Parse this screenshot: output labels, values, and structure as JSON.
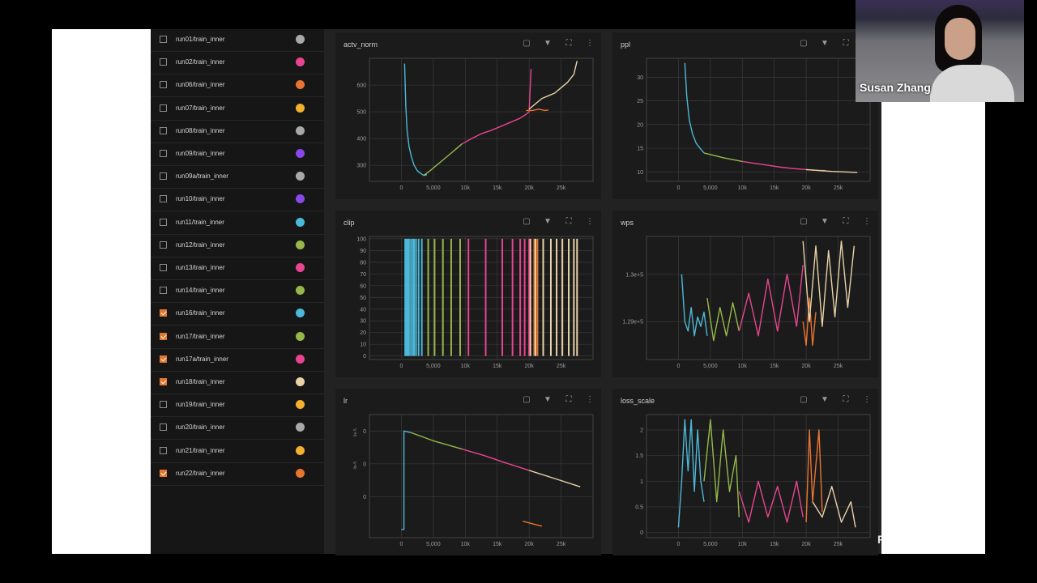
{
  "runs": [
    {
      "label": "run01/train_inner",
      "color": "#a8a8a8",
      "checked": false
    },
    {
      "label": "run02/train_inner",
      "color": "#e84590",
      "checked": false
    },
    {
      "label": "run06/train_inner",
      "color": "#e87530",
      "checked": false
    },
    {
      "label": "run07/train_inner",
      "color": "#f2b02e",
      "checked": false
    },
    {
      "label": "run08/train_inner",
      "color": "#a8a8a8",
      "checked": false
    },
    {
      "label": "run09/train_inner",
      "color": "#8a48e8",
      "checked": false
    },
    {
      "label": "run09a/train_inner",
      "color": "#a8a8a8",
      "checked": false
    },
    {
      "label": "run10/train_inner",
      "color": "#8a48e8",
      "checked": false
    },
    {
      "label": "run11/train_inner",
      "color": "#4db8d8",
      "checked": false
    },
    {
      "label": "run12/train_inner",
      "color": "#96b84a",
      "checked": false
    },
    {
      "label": "run13/train_inner",
      "color": "#e84590",
      "checked": false
    },
    {
      "label": "run14/train_inner",
      "color": "#96b84a",
      "checked": false
    },
    {
      "label": "run16/train_inner",
      "color": "#4db8d8",
      "checked": true
    },
    {
      "label": "run17/train_inner",
      "color": "#96b84a",
      "checked": true
    },
    {
      "label": "run17a/train_inner",
      "color": "#e84590",
      "checked": true
    },
    {
      "label": "run18/train_inner",
      "color": "#e8d2a8",
      "checked": true
    },
    {
      "label": "run19/train_inner",
      "color": "#f2b02e",
      "checked": false
    },
    {
      "label": "run20/train_inner",
      "color": "#a8a8a8",
      "checked": false
    },
    {
      "label": "run21/train_inner",
      "color": "#f2b02e",
      "checked": false
    },
    {
      "label": "run22/train_inner",
      "color": "#e87530",
      "checked": true
    }
  ],
  "icons": {
    "fit": "fit-domain-icon",
    "pin": "pin-icon",
    "fullscreen": "fullscreen-icon",
    "more": "more-vert-icon"
  },
  "colors": {
    "run16": "#4db8d8",
    "run17": "#96b84a",
    "run17a": "#e84590",
    "run18": "#e8d2a8",
    "run22": "#e87530"
  },
  "webcam": {
    "name": "Susan Zhang"
  },
  "watermark": "Powered by Zoom",
  "chart_data": [
    {
      "id": "actv_norm",
      "type": "line",
      "title": "actv_norm",
      "xticks": [
        "0",
        "5,000",
        "10k",
        "15k",
        "20k",
        "25k"
      ],
      "xtick_values": [
        0,
        5000,
        10000,
        15000,
        20000,
        25000
      ],
      "xlim": [
        -5000,
        30000
      ],
      "yticks": [
        "300",
        "400",
        "500",
        "600"
      ],
      "ytick_values": [
        300,
        400,
        500,
        600
      ],
      "ylim": [
        240,
        700
      ],
      "series": [
        {
          "color": "#4db8d8",
          "x": [
            500,
            700,
            900,
            1200,
            1600,
            2000,
            2500,
            3000,
            3500,
            4000
          ],
          "y": [
            680,
            520,
            430,
            370,
            330,
            300,
            280,
            270,
            262,
            265
          ]
        },
        {
          "color": "#96b84a",
          "x": [
            3500,
            4500,
            5500,
            6500,
            7500,
            8500,
            9500
          ],
          "y": [
            262,
            280,
            300,
            320,
            340,
            360,
            380
          ]
        },
        {
          "color": "#e84590",
          "x": [
            9500,
            11000,
            12500,
            14000,
            15500,
            17000,
            18500,
            19500,
            20000,
            20300
          ],
          "y": [
            380,
            400,
            418,
            430,
            445,
            460,
            475,
            490,
            500,
            660
          ]
        },
        {
          "color": "#e87530",
          "x": [
            19500,
            20500,
            21500,
            22500,
            23000
          ],
          "y": [
            505,
            505,
            510,
            505,
            507
          ]
        },
        {
          "color": "#e8d2a8",
          "x": [
            20000,
            21000,
            22000,
            23000,
            24000,
            25000,
            26000,
            27000,
            27500
          ],
          "y": [
            510,
            530,
            550,
            560,
            570,
            590,
            610,
            640,
            690
          ]
        }
      ]
    },
    {
      "id": "ppl",
      "type": "line",
      "title": "ppl",
      "xticks": [
        "0",
        "5,000",
        "10k",
        "15k",
        "20k",
        "25k"
      ],
      "xtick_values": [
        0,
        5000,
        10000,
        15000,
        20000,
        25000
      ],
      "xlim": [
        -5000,
        30000
      ],
      "yticks": [
        "10",
        "15",
        "20",
        "25",
        "30"
      ],
      "ytick_values": [
        10,
        15,
        20,
        25,
        30
      ],
      "ylim": [
        8,
        34
      ],
      "series": [
        {
          "color": "#4db8d8",
          "x": [
            1000,
            1300,
            1700,
            2200,
            2800,
            3500,
            4000
          ],
          "y": [
            33,
            26,
            21,
            18,
            16,
            14.8,
            14
          ]
        },
        {
          "color": "#96b84a",
          "x": [
            4000,
            5500,
            7000,
            8500,
            10000
          ],
          "y": [
            14,
            13.5,
            13,
            12.6,
            12.2
          ]
        },
        {
          "color": "#e84590",
          "x": [
            10000,
            12000,
            14000,
            16000,
            18000,
            20000
          ],
          "y": [
            12.2,
            11.8,
            11.4,
            11,
            10.7,
            10.5
          ]
        },
        {
          "color": "#e87530",
          "x": [
            20000,
            21000,
            22000,
            23000
          ],
          "y": [
            10.5,
            10.4,
            10.3,
            10.3
          ]
        },
        {
          "color": "#e8d2a8",
          "x": [
            20000,
            22000,
            24000,
            26000,
            28000
          ],
          "y": [
            10.5,
            10.3,
            10.1,
            10,
            9.9
          ]
        }
      ]
    },
    {
      "id": "clip",
      "type": "line",
      "title": "clip",
      "xticks": [
        "0",
        "5,000",
        "10k",
        "15k",
        "20k",
        "25k"
      ],
      "xtick_values": [
        0,
        5000,
        10000,
        15000,
        20000,
        25000
      ],
      "xlim": [
        -5000,
        30000
      ],
      "yticks": [
        "0",
        "10",
        "20",
        "30",
        "40",
        "50",
        "60",
        "70",
        "80",
        "90",
        "100"
      ],
      "ytick_values": [
        0,
        10,
        20,
        30,
        40,
        50,
        60,
        70,
        80,
        90,
        100
      ],
      "ylim": [
        -3,
        102
      ],
      "series": [
        {
          "color": "#4db8d8",
          "x": [
            600,
            800,
            1000,
            1200,
            1500,
            1800,
            2000,
            2300,
            2700,
            3200
          ],
          "y": [
            100,
            100,
            100,
            100,
            100,
            100,
            100,
            100,
            100,
            100
          ]
        },
        {
          "color": "#96b84a",
          "x": [
            4200,
            5200,
            6500,
            7800,
            9200
          ],
          "y": [
            100,
            100,
            100,
            100,
            100
          ]
        },
        {
          "color": "#e84590",
          "x": [
            10500,
            13200,
            15800,
            17400,
            18600,
            19300,
            20000
          ],
          "y": [
            100,
            100,
            100,
            100,
            100,
            100,
            100
          ]
        },
        {
          "color": "#e87530",
          "x": [
            20800,
            21300
          ],
          "y": [
            100,
            100
          ]
        },
        {
          "color": "#e8d2a8",
          "x": [
            20200,
            21000,
            22200,
            23400,
            24300,
            25200,
            26200,
            27000,
            27500
          ],
          "y": [
            100,
            100,
            100,
            100,
            100,
            100,
            100,
            100,
            100
          ]
        }
      ]
    },
    {
      "id": "wps",
      "type": "line",
      "title": "wps",
      "xticks": [
        "0",
        "5,000",
        "10k",
        "15k",
        "20k",
        "25k"
      ],
      "xtick_values": [
        0,
        5000,
        10000,
        15000,
        20000,
        25000
      ],
      "xlim": [
        -5000,
        30000
      ],
      "yticks": [
        "1.29e+5",
        "1.3e+5"
      ],
      "ytick_values": [
        129000,
        130000
      ],
      "ylim": [
        128200,
        130800
      ],
      "series": [
        {
          "color": "#4db8d8",
          "x": [
            500,
            1000,
            1500,
            2000,
            2500,
            3000,
            3500,
            4000,
            4500
          ],
          "y": [
            130000,
            129000,
            128800,
            129300,
            128700,
            129100,
            128900,
            129200,
            128700
          ]
        },
        {
          "color": "#96b84a",
          "x": [
            4500,
            5500,
            6500,
            7500,
            8500,
            9500
          ],
          "y": [
            129500,
            128600,
            129300,
            128700,
            129400,
            128800
          ]
        },
        {
          "color": "#e84590",
          "x": [
            9500,
            11000,
            12500,
            14000,
            15500,
            17000,
            18500,
            19500
          ],
          "y": [
            128800,
            129600,
            128700,
            129900,
            128800,
            130000,
            128900,
            130200
          ]
        },
        {
          "color": "#e87530",
          "x": [
            19500,
            20000,
            20500,
            21000,
            21500
          ],
          "y": [
            129000,
            128500,
            129500,
            128500,
            129200
          ]
        },
        {
          "color": "#e8d2a8",
          "x": [
            19500,
            20500,
            21500,
            22500,
            23500,
            24500,
            25500,
            26500,
            27500
          ],
          "y": [
            130700,
            129000,
            130600,
            128900,
            130500,
            129100,
            130700,
            129300,
            130600
          ]
        }
      ]
    },
    {
      "id": "lr",
      "type": "line",
      "title": "lr",
      "xticks": [
        "0",
        "5,000",
        "10k",
        "15k",
        "20k",
        "25k"
      ],
      "xtick_values": [
        0,
        5000,
        10000,
        15000,
        20000,
        25000
      ],
      "xlim": [
        -5000,
        30000
      ],
      "yticks": [
        "0",
        "0",
        "0"
      ],
      "ytick_values": [
        2,
        4,
        6
      ],
      "ylabel_marks": [
        "6e-5",
        "4e-5"
      ],
      "ylim": [
        -0.5,
        7
      ],
      "series": [
        {
          "color": "#4db8d8",
          "x": [
            0,
            400,
            400,
            1500
          ],
          "y": [
            0,
            0,
            6,
            5.9
          ]
        },
        {
          "color": "#96b84a",
          "x": [
            1500,
            5000,
            9500
          ],
          "y": [
            5.9,
            5.4,
            4.9
          ]
        },
        {
          "color": "#e84590",
          "x": [
            9500,
            13000,
            16000,
            20000
          ],
          "y": [
            4.9,
            4.5,
            4.1,
            3.6
          ]
        },
        {
          "color": "#e8d2a8",
          "x": [
            20000,
            24000,
            28000
          ],
          "y": [
            3.6,
            3.1,
            2.6
          ]
        },
        {
          "color": "#e87530",
          "x": [
            19000,
            20500,
            22000
          ],
          "y": [
            0.5,
            0.35,
            0.2
          ]
        }
      ]
    },
    {
      "id": "loss_scale",
      "type": "line",
      "title": "loss_scale",
      "xticks": [
        "0",
        "5,000",
        "10k",
        "15k",
        "20k",
        "25k"
      ],
      "xtick_values": [
        0,
        5000,
        10000,
        15000,
        20000,
        25000
      ],
      "xlim": [
        -5000,
        30000
      ],
      "yticks": [
        "0",
        "0.5",
        "1",
        "1.5",
        "2"
      ],
      "ytick_values": [
        0,
        0.5,
        1,
        1.5,
        2
      ],
      "ylim": [
        -0.1,
        2.3
      ],
      "series": [
        {
          "color": "#4db8d8",
          "x": [
            0,
            500,
            1000,
            1500,
            2000,
            2500,
            3000,
            3500,
            4000
          ],
          "y": [
            0.1,
            1,
            2.2,
            1.2,
            2.2,
            0.8,
            2,
            1,
            0.6
          ]
        },
        {
          "color": "#96b84a",
          "x": [
            4000,
            5000,
            6000,
            7000,
            8000,
            9000,
            9500
          ],
          "y": [
            1,
            2.2,
            0.6,
            2,
            0.8,
            1.5,
            0.3
          ]
        },
        {
          "color": "#e84590",
          "x": [
            9500,
            11000,
            12500,
            14000,
            15500,
            17000,
            18500,
            19500
          ],
          "y": [
            0.8,
            0.2,
            1,
            0.3,
            0.9,
            0.2,
            1,
            0.3
          ]
        },
        {
          "color": "#e87530",
          "x": [
            20000,
            20500,
            21000,
            22000,
            22500
          ],
          "y": [
            0.2,
            2,
            0.6,
            2,
            0.4
          ]
        },
        {
          "color": "#e8d2a8",
          "x": [
            21000,
            22500,
            24000,
            25500,
            27000,
            27700
          ],
          "y": [
            0.6,
            0.3,
            0.9,
            0.2,
            0.6,
            0.1
          ]
        }
      ]
    }
  ]
}
